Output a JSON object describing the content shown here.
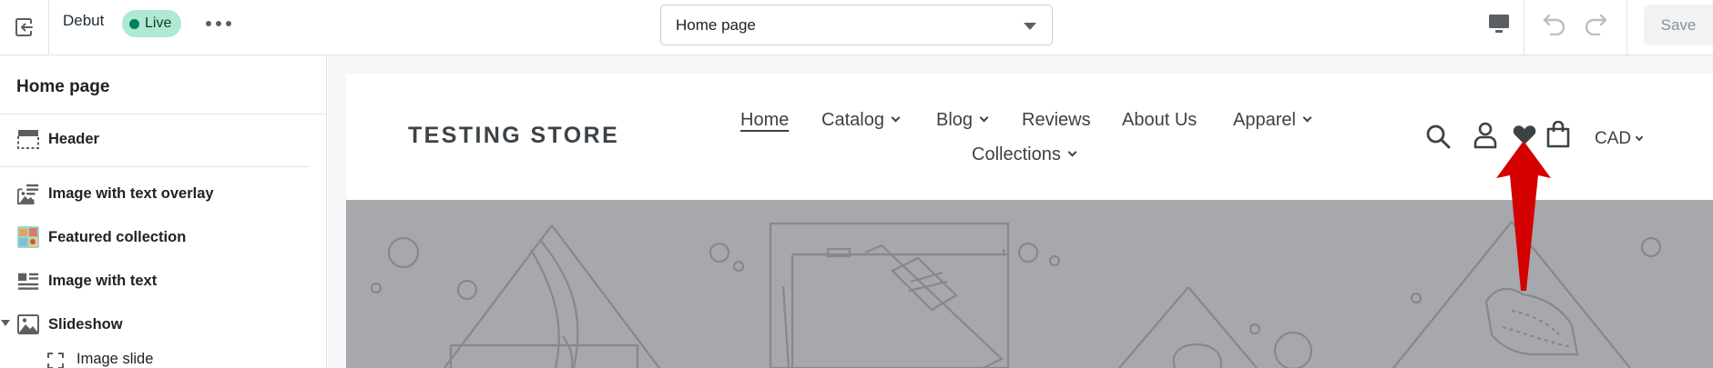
{
  "topbar": {
    "theme_name": "Debut",
    "live_badge": "Live",
    "page_selector_value": "Home page",
    "save_label": "Save"
  },
  "sidebar": {
    "title": "Home page",
    "header_item": "Header",
    "items": [
      {
        "label": "Image with text overlay",
        "icon": "image-overlay-icon"
      },
      {
        "label": "Featured collection",
        "icon": "collection-thumbnail-icon"
      },
      {
        "label": "Image with text",
        "icon": "image-text-icon"
      },
      {
        "label": "Slideshow",
        "icon": "image-icon"
      }
    ],
    "sub_item": "Image slide"
  },
  "store": {
    "logo": "TESTING STORE",
    "nav": [
      {
        "label": "Home",
        "active": true
      },
      {
        "label": "Catalog",
        "dropdown": true
      },
      {
        "label": "Blog",
        "dropdown": true
      },
      {
        "label": "Reviews"
      },
      {
        "label": "About Us"
      },
      {
        "label": "Apparel",
        "dropdown": true
      },
      {
        "label": "Collections",
        "dropdown": true
      }
    ],
    "currency": "CAD"
  },
  "colors": {
    "live_badge_bg": "#aee9d1",
    "live_dot": "#007f5f",
    "slideshow_bg": "#a6a8ab",
    "annotation_arrow": "#d40000"
  }
}
